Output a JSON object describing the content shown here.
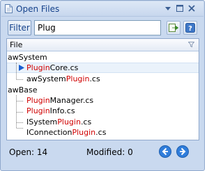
{
  "window": {
    "title": "Open Files"
  },
  "titlebar_buttons": [
    "dropdown-arrow",
    "maximize",
    "close"
  ],
  "filter": {
    "button_label": "Filter",
    "input_value": "Plug"
  },
  "toolbar_icons": [
    "goto-file-icon",
    "help-icon"
  ],
  "column_header": {
    "label": "File"
  },
  "groups": [
    {
      "name": "awSystem",
      "files": [
        {
          "prefix": "",
          "match": "Plugin",
          "suffix": "Core.cs",
          "current": true
        },
        {
          "prefix": "awSystem",
          "match": "Plugin",
          "suffix": ".cs",
          "current": false
        }
      ]
    },
    {
      "name": "awBase",
      "files": [
        {
          "prefix": "",
          "match": "Plugin",
          "suffix": "Manager.cs",
          "current": false
        },
        {
          "prefix": "",
          "match": "Plugin",
          "suffix": "Info.cs",
          "current": false
        },
        {
          "prefix": "ISystem",
          "match": "Plugin",
          "suffix": ".cs",
          "current": false
        },
        {
          "prefix": "IConnection",
          "match": "Plugin",
          "suffix": ".cs",
          "current": false
        }
      ]
    }
  ],
  "status": {
    "open_label": "Open: 14",
    "modified_label": "Modified: 0"
  },
  "colors": {
    "match_highlight": "#d00000",
    "accent": "#15428b",
    "nav_button": "#2f7ddb"
  }
}
